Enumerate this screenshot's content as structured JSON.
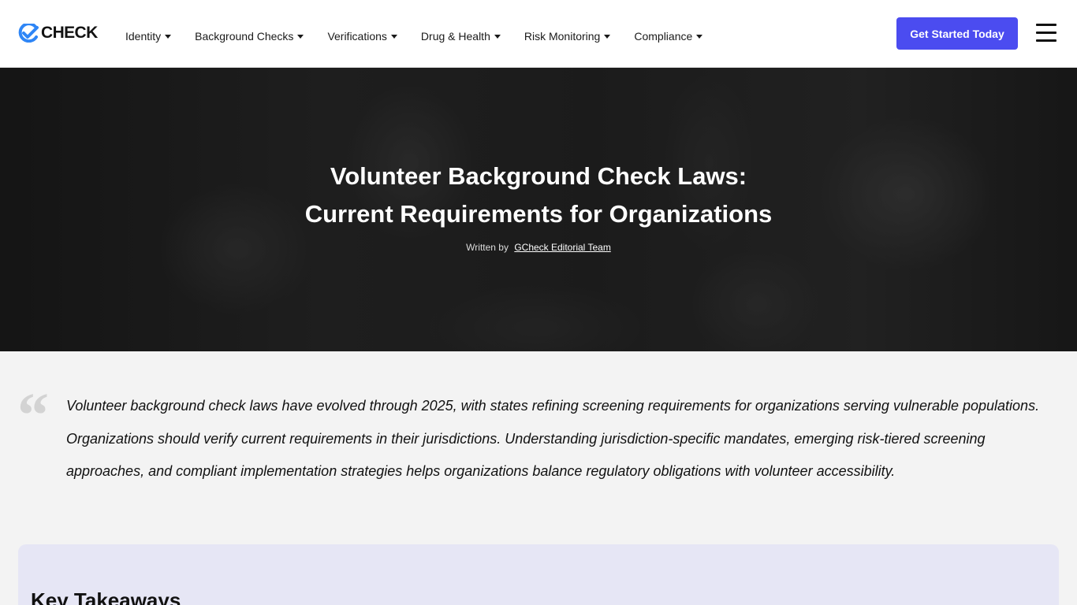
{
  "brand": {
    "logo_text": "CHECK",
    "accent_color": "#4b4cf0",
    "logo_blue": "#2f86f6"
  },
  "nav": {
    "items": [
      {
        "label": "Identity"
      },
      {
        "label": "Background Checks"
      },
      {
        "label": "Verifications"
      },
      {
        "label": "Drug & Health"
      },
      {
        "label": "Risk Monitoring"
      },
      {
        "label": "Compliance"
      }
    ],
    "cta_label": "Get Started Today",
    "menu_icon": "hamburger-menu-icon"
  },
  "hero": {
    "title_line1": "Volunteer Background Check Laws:",
    "title_line2": "Current Requirements for Organizations",
    "byline_prefix": "Written by",
    "author": "GCheck Editorial Team"
  },
  "quote": {
    "mark": "“",
    "text": "Volunteer background check laws have evolved through 2025, with states refining screening requirements for organizations serving vulnerable populations. Organizations should verify current requirements in their jurisdictions. Understanding jurisdiction-specific mandates, emerging risk-tiered screening approaches, and compliant implementation strategies helps organizations balance regulatory obligations with volunteer accessibility."
  },
  "takeaways": {
    "heading": "Key Takeaways"
  }
}
